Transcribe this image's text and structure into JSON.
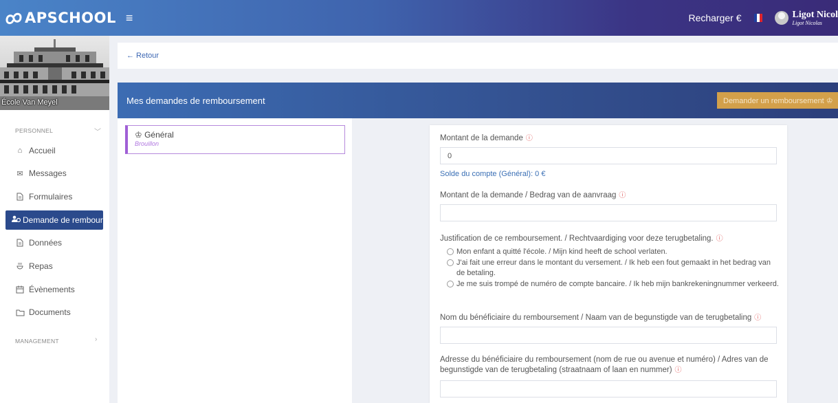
{
  "app": {
    "name": "APSCHOOL",
    "recharge_label": "Recharger €",
    "user_name": "Ligot Nicol",
    "user_sub": "Ligot Nicolas"
  },
  "colors": {
    "primary": "#2b4a8c",
    "accent_button": "#d3a04a",
    "draft_purple": "#a05fd6",
    "required": "#e05a5a"
  },
  "sidebar": {
    "school_name": "École Van Meyel",
    "sections": [
      {
        "label": "PERSONNEL"
      },
      {
        "label": "MANAGEMENT"
      }
    ],
    "items": [
      {
        "label": "Accueil",
        "icon": "home-icon"
      },
      {
        "label": "Messages",
        "icon": "envelope-icon"
      },
      {
        "label": "Formulaires",
        "icon": "file-icon"
      },
      {
        "label": "Demande de rembourse",
        "icon": "users-money-icon",
        "active": true
      },
      {
        "label": "Données",
        "icon": "file-icon"
      },
      {
        "label": "Repas",
        "icon": "food-icon"
      },
      {
        "label": "Évènements",
        "icon": "calendar-icon"
      },
      {
        "label": "Documents",
        "icon": "folder-icon"
      }
    ]
  },
  "back_label": "← Retour",
  "page": {
    "title": "Mes demandes de remboursement",
    "request_button": "Demander un remboursement ♔"
  },
  "requests": [
    {
      "title": "♔ Général",
      "status": "Brouillon"
    }
  ],
  "form": {
    "amount_label": "Montant de la demande",
    "amount_value": "0",
    "balance_text": "Solde du compte (Général): 0 €",
    "amount_nl_label": "Montant de la demande / Bedrag van de aanvraag",
    "justification_label": "Justification de ce remboursement. / Rechtvaardiging voor deze terugbetaling.",
    "options": [
      "Mon enfant a quitté l'école. / Mijn kind heeft de school verlaten.",
      "J'ai fait une erreur dans le montant du versement. / Ik heb een fout gemaakt in het bedrag van de betaling.",
      "Je me suis trompé de numéro de compte bancaire. / Ik heb mijn bankrekeningnummer verkeerd."
    ],
    "beneficiary_label": "Nom du bénéficiaire du remboursement / Naam van de begunstigde van de terugbetaling",
    "address_label": "Adresse du bénéficiaire du remboursement (nom de rue ou avenue et numéro) / Adres van de begunstigde van de terugbetaling (straatnaam of laan en nummer)"
  }
}
